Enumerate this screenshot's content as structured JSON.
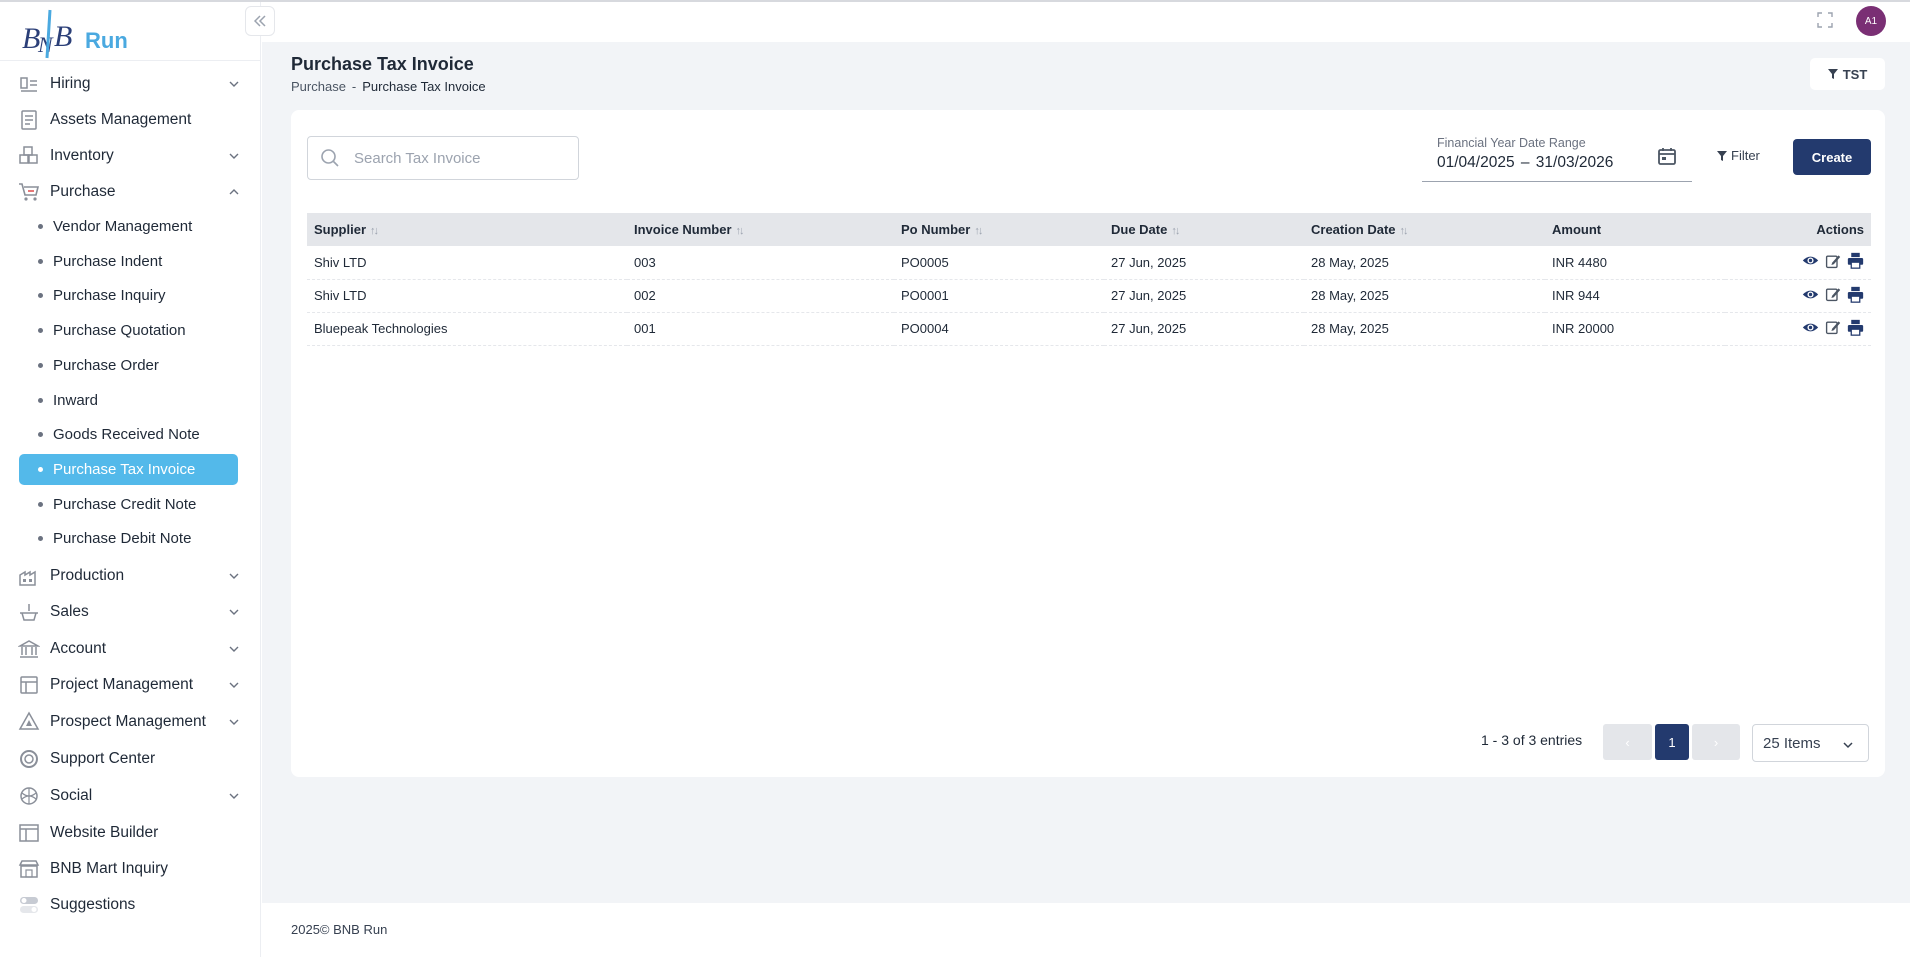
{
  "brand": {
    "logo_text": "Run"
  },
  "sidebar": {
    "top_items": [
      {
        "label": "Hiring",
        "icon": "hiring-icon",
        "expandable": true
      },
      {
        "label": "Assets Management",
        "icon": "assets-icon",
        "expandable": false
      },
      {
        "label": "Inventory",
        "icon": "inventory-icon",
        "expandable": true
      },
      {
        "label": "Purchase",
        "icon": "cart-icon",
        "expandable": true,
        "expanded": true
      }
    ],
    "purchase_sub": [
      {
        "label": "Vendor Management",
        "active": false
      },
      {
        "label": "Purchase Indent",
        "active": false
      },
      {
        "label": "Purchase Inquiry",
        "active": false
      },
      {
        "label": "Purchase Quotation",
        "active": false
      },
      {
        "label": "Purchase Order",
        "active": false
      },
      {
        "label": "Inward",
        "active": false
      },
      {
        "label": "Goods Received Note",
        "active": false
      },
      {
        "label": "Purchase Tax Invoice",
        "active": true
      },
      {
        "label": "Purchase Credit Note",
        "active": false
      },
      {
        "label": "Purchase Debit Note",
        "active": false
      }
    ],
    "bottom_items": [
      {
        "label": "Production",
        "icon": "production-icon",
        "expandable": true
      },
      {
        "label": "Sales",
        "icon": "sales-icon",
        "expandable": true
      },
      {
        "label": "Account",
        "icon": "bank-icon",
        "expandable": true
      },
      {
        "label": "Project Management",
        "icon": "project-icon",
        "expandable": true
      },
      {
        "label": "Prospect Management",
        "icon": "prospect-icon",
        "expandable": true
      },
      {
        "label": "Support Center",
        "icon": "support-icon",
        "expandable": false
      },
      {
        "label": "Social",
        "icon": "social-icon",
        "expandable": true
      },
      {
        "label": "Website Builder",
        "icon": "layout-icon",
        "expandable": false
      },
      {
        "label": "BNB Mart Inquiry",
        "icon": "store-icon",
        "expandable": false
      },
      {
        "label": "Suggestions",
        "icon": "toggle-icon",
        "expandable": false
      }
    ]
  },
  "header": {
    "avatar_initials": "A1"
  },
  "page": {
    "title": "Purchase Tax Invoice",
    "breadcrumb": {
      "parent": "Purchase",
      "separator": "-",
      "current": "Purchase Tax Invoice"
    },
    "tst_label": "TST"
  },
  "toolbar": {
    "search_placeholder": "Search Tax Invoice",
    "date_label": "Financial Year Date Range",
    "date_value": "01/04/2025 – 31/03/2026",
    "filter_label": "Filter",
    "create_label": "Create"
  },
  "table": {
    "columns": [
      "Supplier",
      "Invoice Number",
      "Po Number",
      "Due Date",
      "Creation Date",
      "Amount",
      "Actions"
    ],
    "rows": [
      {
        "supplier": "Shiv LTD",
        "invoice": "003",
        "po": "PO0005",
        "due": "27 Jun, 2025",
        "created": "28 May, 2025",
        "amount": "INR 4480"
      },
      {
        "supplier": "Shiv LTD",
        "invoice": "002",
        "po": "PO0001",
        "due": "27 Jun, 2025",
        "created": "28 May, 2025",
        "amount": "INR 944"
      },
      {
        "supplier": "Bluepeak Technologies",
        "invoice": "001",
        "po": "PO0004",
        "due": "27 Jun, 2025",
        "created": "28 May, 2025",
        "amount": "INR 20000"
      }
    ]
  },
  "pagination": {
    "info": "1 - 3 of 3 entries",
    "prev": "‹",
    "current_page": "1",
    "next": "›",
    "per_page": "25 Items"
  },
  "footer": {
    "text": "2025© BNB Run"
  },
  "colors": {
    "primary": "#233a6e",
    "active_nav": "#53b9ea",
    "avatar": "#7a2f74"
  }
}
